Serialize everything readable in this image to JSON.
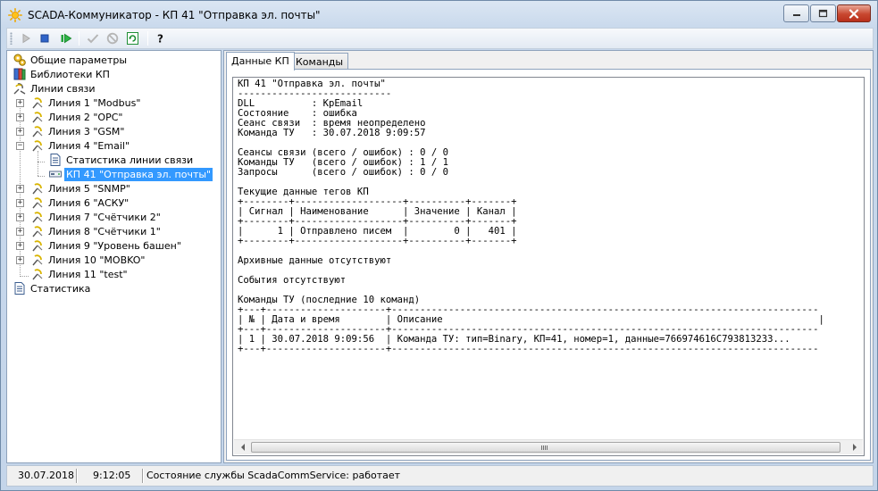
{
  "window": {
    "title": "SCADA-Коммуникатор - КП 41 \"Отправка эл. почты\""
  },
  "toolbar": {
    "buttons": [
      {
        "name": "start-icon"
      },
      {
        "name": "stop-icon"
      },
      {
        "name": "restart-icon"
      },
      {
        "name": "apply-check-icon"
      },
      {
        "name": "cancel-icon"
      },
      {
        "name": "refresh-icon"
      },
      {
        "name": "help-icon"
      }
    ]
  },
  "tree": {
    "items": [
      {
        "label": "Общие параметры",
        "icon": "gears-icon"
      },
      {
        "label": "Библиотеки КП",
        "icon": "library-icon"
      },
      {
        "label": "Линии связи",
        "icon": "comm-lines-icon"
      },
      {
        "label": "Линия 1 \"Modbus\"",
        "icon": "comm-line-icon"
      },
      {
        "label": "Линия 2 \"OPC\"",
        "icon": "comm-line-icon"
      },
      {
        "label": "Линия 3 \"GSM\"",
        "icon": "comm-line-icon"
      },
      {
        "label": "Линия 4 \"Email\"",
        "icon": "comm-line-icon"
      },
      {
        "label": "Статистика линии связи",
        "icon": "document-icon"
      },
      {
        "label": "КП 41 \"Отправка эл. почты\"",
        "icon": "device-icon"
      },
      {
        "label": "Линия 5 \"SNMP\"",
        "icon": "comm-line-icon"
      },
      {
        "label": "Линия 6 \"АСКУ\"",
        "icon": "comm-line-icon"
      },
      {
        "label": "Линия 7 \"Счётчики 2\"",
        "icon": "comm-line-icon"
      },
      {
        "label": "Линия 8 \"Счётчики 1\"",
        "icon": "comm-line-icon"
      },
      {
        "label": "Линия 9 \"Уровень башен\"",
        "icon": "comm-line-icon"
      },
      {
        "label": "Линия 10 \"MOBKO\"",
        "icon": "comm-line-icon"
      },
      {
        "label": "Линия 11 \"test\"",
        "icon": "comm-line-icon"
      },
      {
        "label": "Статистика",
        "icon": "document-icon"
      }
    ],
    "selected_label": "КП 41 \"Отправка эл. почты\""
  },
  "tabs": [
    {
      "label": "Данные КП",
      "active": true
    },
    {
      "label": "Команды",
      "active": false
    }
  ],
  "kp_data": {
    "lines": [
      "КП 41 \"Отправка эл. почты\"",
      "---------------------------",
      "DLL          : KpEmail",
      "Состояние    : ошибка",
      "Сеанс связи  : время неопределено",
      "Команда ТУ   : 30.07.2018 9:09:57",
      "",
      "Сеансы связи (всего / ошибок) : 0 / 0",
      "Команды ТУ   (всего / ошибок) : 1 / 1",
      "Запросы      (всего / ошибок) : 0 / 0",
      "",
      "Текущие данные тегов КП",
      "+--------+-------------------+----------+-------+",
      "| Сигнал | Наименование      | Значение | Канал |",
      "+--------+-------------------+----------+-------+",
      "|      1 | Отправлено писем  |        0 |   401 |",
      "+--------+-------------------+----------+-------+",
      "",
      "Архивные данные отсутствуют",
      "",
      "События отсутствуют",
      "",
      "Команды ТУ (последние 10 команд)",
      "+---+---------------------+---------------------------------------------------------------------------",
      "| № | Дата и время        | Описание                                                                  |",
      "+---+---------------------+---------------------------------------------------------------------------",
      "| 1 | 30.07.2018 9:09:56  | Команда ТУ: тип=Binary, КП=41, номер=1, данные=766974616C793813233...",
      "+---+---------------------+---------------------------------------------------------------------------"
    ]
  },
  "status": {
    "date": "30.07.2018",
    "time": "9:12:05",
    "service_state": "Состояние службы ScadaCommService: работает"
  },
  "colors": {
    "selection": "#3399ff",
    "window_frame": "#c4d5ea"
  }
}
